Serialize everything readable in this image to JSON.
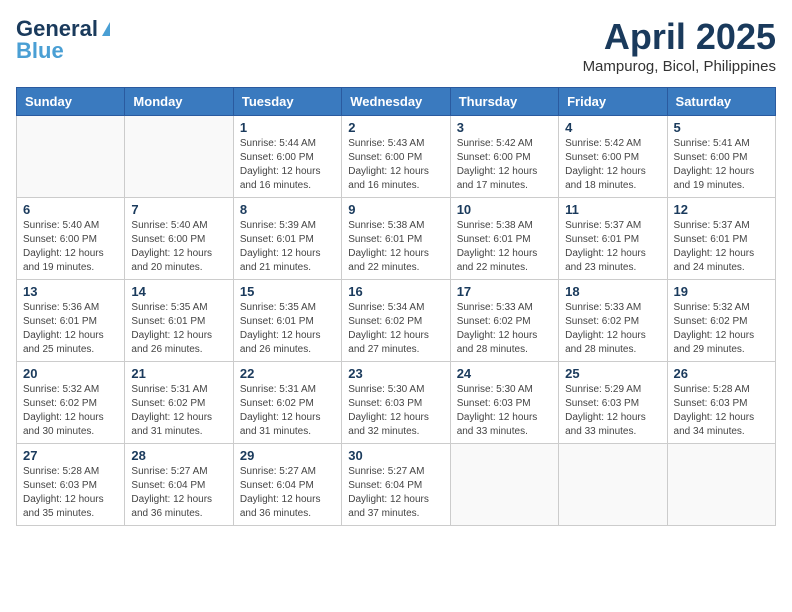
{
  "header": {
    "logo_general": "General",
    "logo_blue": "Blue",
    "month_title": "April 2025",
    "location": "Mampurog, Bicol, Philippines"
  },
  "days_of_week": [
    "Sunday",
    "Monday",
    "Tuesday",
    "Wednesday",
    "Thursday",
    "Friday",
    "Saturday"
  ],
  "weeks": [
    [
      {
        "day": null
      },
      {
        "day": null
      },
      {
        "day": "1",
        "sunrise": "5:44 AM",
        "sunset": "6:00 PM",
        "daylight": "12 hours and 16 minutes."
      },
      {
        "day": "2",
        "sunrise": "5:43 AM",
        "sunset": "6:00 PM",
        "daylight": "12 hours and 16 minutes."
      },
      {
        "day": "3",
        "sunrise": "5:42 AM",
        "sunset": "6:00 PM",
        "daylight": "12 hours and 17 minutes."
      },
      {
        "day": "4",
        "sunrise": "5:42 AM",
        "sunset": "6:00 PM",
        "daylight": "12 hours and 18 minutes."
      },
      {
        "day": "5",
        "sunrise": "5:41 AM",
        "sunset": "6:00 PM",
        "daylight": "12 hours and 19 minutes."
      }
    ],
    [
      {
        "day": "6",
        "sunrise": "5:40 AM",
        "sunset": "6:00 PM",
        "daylight": "12 hours and 19 minutes."
      },
      {
        "day": "7",
        "sunrise": "5:40 AM",
        "sunset": "6:00 PM",
        "daylight": "12 hours and 20 minutes."
      },
      {
        "day": "8",
        "sunrise": "5:39 AM",
        "sunset": "6:01 PM",
        "daylight": "12 hours and 21 minutes."
      },
      {
        "day": "9",
        "sunrise": "5:38 AM",
        "sunset": "6:01 PM",
        "daylight": "12 hours and 22 minutes."
      },
      {
        "day": "10",
        "sunrise": "5:38 AM",
        "sunset": "6:01 PM",
        "daylight": "12 hours and 22 minutes."
      },
      {
        "day": "11",
        "sunrise": "5:37 AM",
        "sunset": "6:01 PM",
        "daylight": "12 hours and 23 minutes."
      },
      {
        "day": "12",
        "sunrise": "5:37 AM",
        "sunset": "6:01 PM",
        "daylight": "12 hours and 24 minutes."
      }
    ],
    [
      {
        "day": "13",
        "sunrise": "5:36 AM",
        "sunset": "6:01 PM",
        "daylight": "12 hours and 25 minutes."
      },
      {
        "day": "14",
        "sunrise": "5:35 AM",
        "sunset": "6:01 PM",
        "daylight": "12 hours and 26 minutes."
      },
      {
        "day": "15",
        "sunrise": "5:35 AM",
        "sunset": "6:01 PM",
        "daylight": "12 hours and 26 minutes."
      },
      {
        "day": "16",
        "sunrise": "5:34 AM",
        "sunset": "6:02 PM",
        "daylight": "12 hours and 27 minutes."
      },
      {
        "day": "17",
        "sunrise": "5:33 AM",
        "sunset": "6:02 PM",
        "daylight": "12 hours and 28 minutes."
      },
      {
        "day": "18",
        "sunrise": "5:33 AM",
        "sunset": "6:02 PM",
        "daylight": "12 hours and 28 minutes."
      },
      {
        "day": "19",
        "sunrise": "5:32 AM",
        "sunset": "6:02 PM",
        "daylight": "12 hours and 29 minutes."
      }
    ],
    [
      {
        "day": "20",
        "sunrise": "5:32 AM",
        "sunset": "6:02 PM",
        "daylight": "12 hours and 30 minutes."
      },
      {
        "day": "21",
        "sunrise": "5:31 AM",
        "sunset": "6:02 PM",
        "daylight": "12 hours and 31 minutes."
      },
      {
        "day": "22",
        "sunrise": "5:31 AM",
        "sunset": "6:02 PM",
        "daylight": "12 hours and 31 minutes."
      },
      {
        "day": "23",
        "sunrise": "5:30 AM",
        "sunset": "6:03 PM",
        "daylight": "12 hours and 32 minutes."
      },
      {
        "day": "24",
        "sunrise": "5:30 AM",
        "sunset": "6:03 PM",
        "daylight": "12 hours and 33 minutes."
      },
      {
        "day": "25",
        "sunrise": "5:29 AM",
        "sunset": "6:03 PM",
        "daylight": "12 hours and 33 minutes."
      },
      {
        "day": "26",
        "sunrise": "5:28 AM",
        "sunset": "6:03 PM",
        "daylight": "12 hours and 34 minutes."
      }
    ],
    [
      {
        "day": "27",
        "sunrise": "5:28 AM",
        "sunset": "6:03 PM",
        "daylight": "12 hours and 35 minutes."
      },
      {
        "day": "28",
        "sunrise": "5:27 AM",
        "sunset": "6:04 PM",
        "daylight": "12 hours and 36 minutes."
      },
      {
        "day": "29",
        "sunrise": "5:27 AM",
        "sunset": "6:04 PM",
        "daylight": "12 hours and 36 minutes."
      },
      {
        "day": "30",
        "sunrise": "5:27 AM",
        "sunset": "6:04 PM",
        "daylight": "12 hours and 37 minutes."
      },
      {
        "day": null
      },
      {
        "day": null
      },
      {
        "day": null
      }
    ]
  ]
}
